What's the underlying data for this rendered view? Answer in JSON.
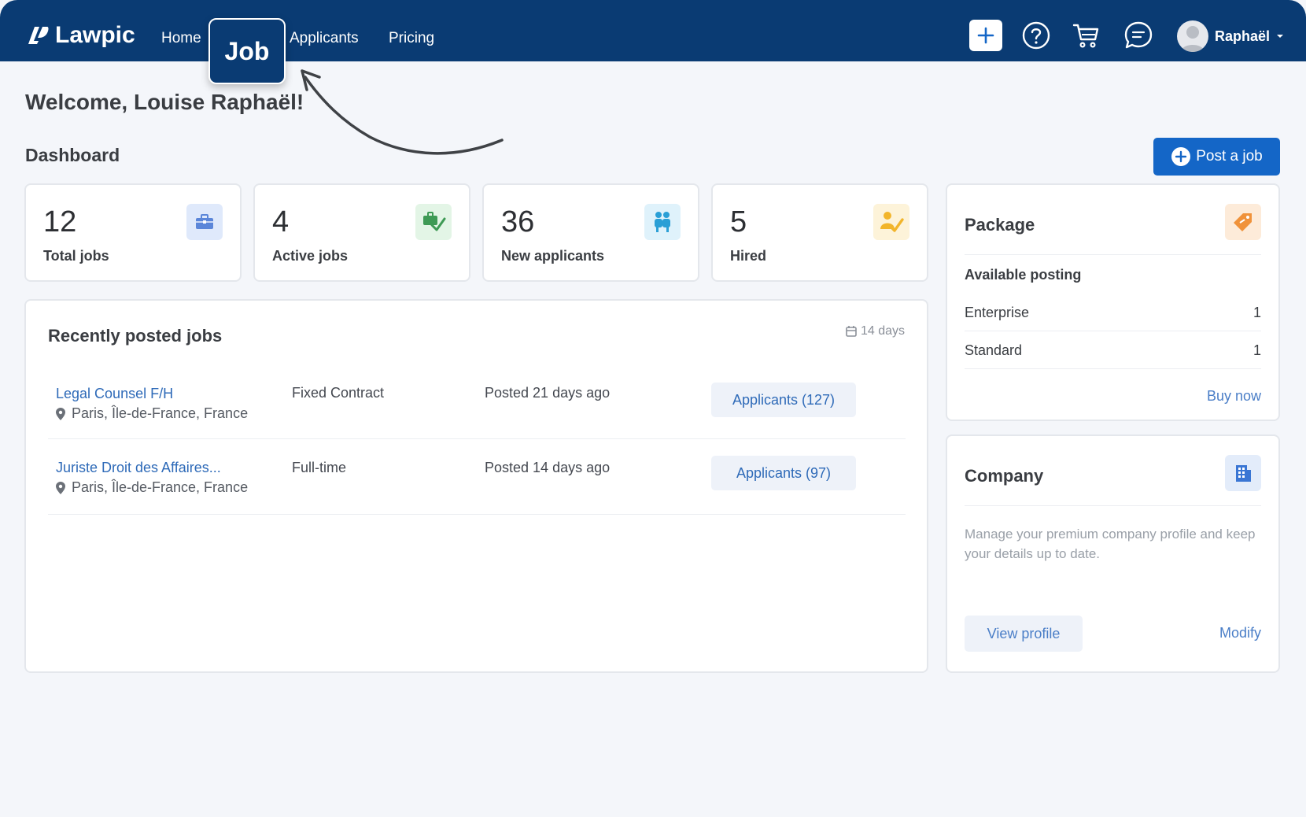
{
  "nav": {
    "brand": "Lawpic",
    "home": "Home",
    "job": "Job",
    "applicants": "Applicants",
    "pricing": "Pricing",
    "user_name": "Raphaël"
  },
  "welcome": "Welcome, Louise Raphaël!",
  "dashboard": {
    "title": "Dashboard",
    "post_job_label": "Post a job"
  },
  "stats": [
    {
      "value": "12",
      "label": "Total jobs",
      "icon": "briefcase-icon",
      "color": "#dfe9fb"
    },
    {
      "value": "4",
      "label": "Active jobs",
      "icon": "briefcase-check-icon",
      "color": "#e3f5e6"
    },
    {
      "value": "36",
      "label": "New applicants",
      "icon": "people-icon",
      "color": "#dff2fb"
    },
    {
      "value": "5",
      "label": "Hired",
      "icon": "hired-icon",
      "color": "#fdf3d9"
    }
  ],
  "recent": {
    "title": "Recently posted jobs",
    "range": "14 days",
    "jobs": [
      {
        "title": "Legal Counsel F/H",
        "location": "Paris, Île-de-France, France",
        "type": "Fixed Contract",
        "posted": "Posted 21 days ago",
        "applicants": "Applicants  (127)"
      },
      {
        "title": "Juriste Droit des Affaires...",
        "location": "Paris, Île-de-France, France",
        "type": "Full-time",
        "posted": "Posted 14 days ago",
        "applicants": "Applicants  (97)"
      }
    ]
  },
  "package": {
    "title": "Package",
    "subtitle": "Available posting",
    "rows": [
      {
        "name": "Enterprise",
        "count": "1"
      },
      {
        "name": "Standard",
        "count": "1"
      }
    ],
    "buy_now": "Buy now"
  },
  "company": {
    "title": "Company",
    "description": "Manage your premium company profile and keep your details up to date.",
    "view_profile": "View profile",
    "modify": "Modify"
  },
  "colors": {
    "nav_bg": "#0a3b73",
    "accent": "#1466c7",
    "link": "#2e6ab8"
  }
}
